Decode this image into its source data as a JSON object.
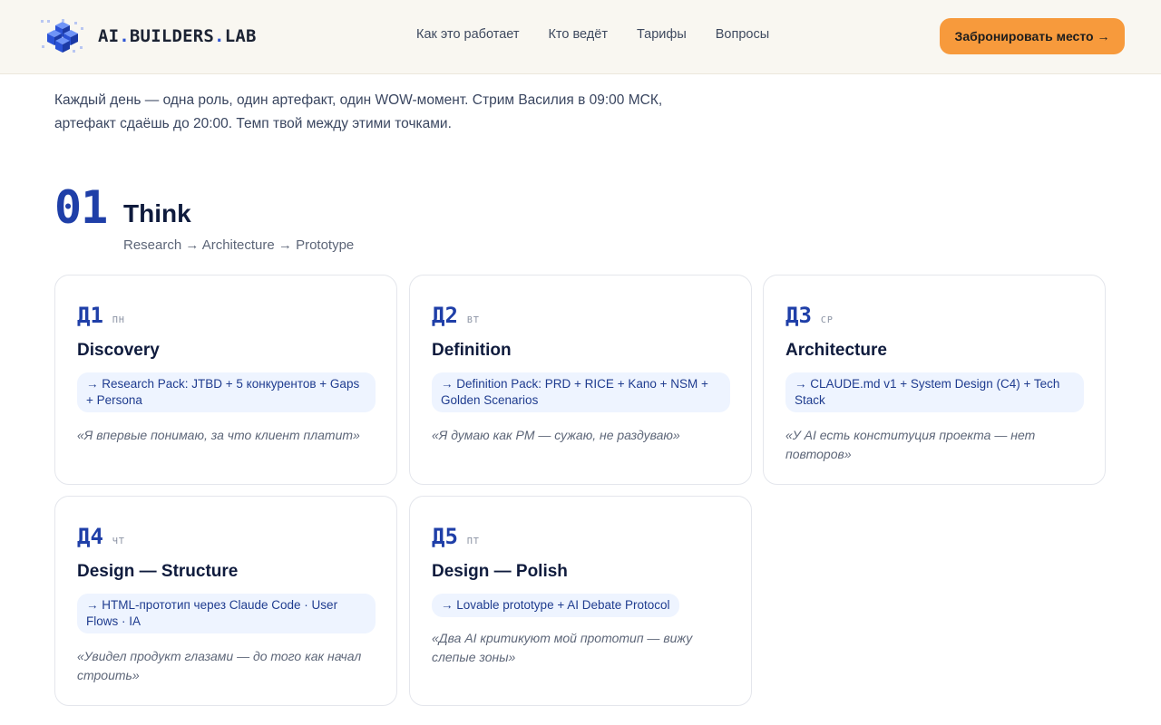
{
  "header": {
    "logo": {
      "part1": "AI",
      "dot1": ".",
      "part2": "BUILDERS",
      "dot2": ".",
      "part3": "LAB"
    },
    "nav": [
      "Как это работает",
      "Кто ведёт",
      "Тарифы",
      "Вопросы"
    ],
    "cta": "Забронировать место →"
  },
  "intro": "Каждый день — одна роль, один артефакт, один WOW-момент. Стрим Василия в 09:00 МСК, артефакт сдаёшь до 20:00. Темп твой между этими точками.",
  "section": {
    "number": "01",
    "title": "Think",
    "subtitle": "Research → Architecture → Prototype"
  },
  "days": [
    {
      "num": "Д1",
      "weekday": "ПН",
      "title": "Discovery",
      "artifact": "→ Research Pack: JTBD + 5 конкурентов + Gaps + Persona",
      "quote": "«Я впервые понимаю, за что клиент платит»"
    },
    {
      "num": "Д2",
      "weekday": "ВТ",
      "title": "Definition",
      "artifact": "→ Definition Pack: PRD + RICE + Kano + NSM + Golden Scenarios",
      "quote": "«Я думаю как PM — сужаю, не раздуваю»"
    },
    {
      "num": "Д3",
      "weekday": "СР",
      "title": "Architecture",
      "artifact": "→ CLAUDE.md v1 + System Design (C4) + Tech Stack",
      "quote": "«У AI есть конституция проекта — нет повторов»"
    },
    {
      "num": "Д4",
      "weekday": "ЧТ",
      "title": "Design — Structure",
      "artifact": "→ HTML-прототип через Claude Code · User Flows · IA",
      "quote": "«Увидел продукт глазами — до того как начал строить»"
    },
    {
      "num": "Д5",
      "weekday": "ПТ",
      "title": "Design — Polish",
      "artifact": "→ Lovable prototype + AI Debate Protocol",
      "quote": "«Два AI критикуют мой прототип — вижу слепые зоны»"
    }
  ],
  "colors": {
    "accent": "#1f3fa8",
    "cta": "#f79a3c",
    "chip_bg": "#eef4ff",
    "header_bg": "#f9f7f1"
  }
}
